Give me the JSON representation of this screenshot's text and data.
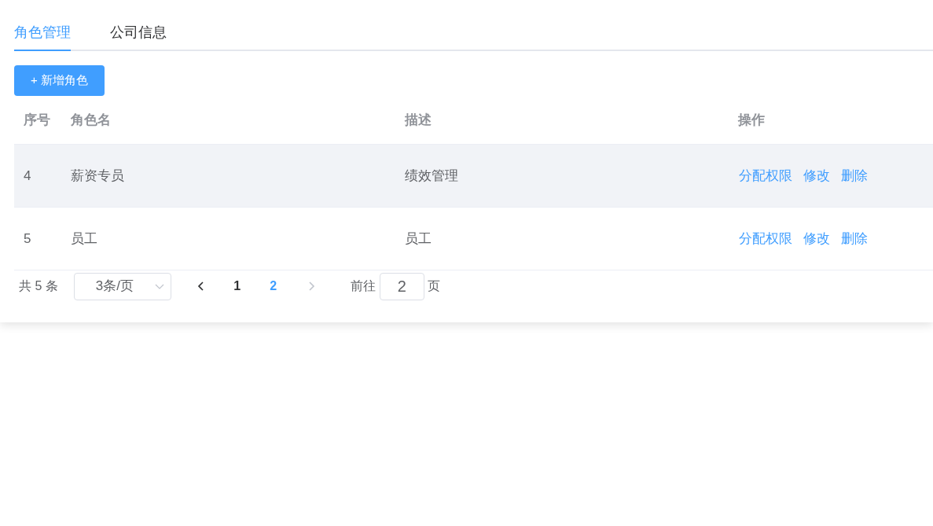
{
  "tabs": [
    {
      "label": "角色管理",
      "selected": true
    },
    {
      "label": "公司信息",
      "selected": false
    }
  ],
  "add_button": {
    "label": "+ 新增角色"
  },
  "table": {
    "columns": [
      "序号",
      "角色名",
      "描述",
      "操作"
    ],
    "rows": [
      {
        "index": "4",
        "name": "薪资专员",
        "description": "绩效管理",
        "hovered": true,
        "actions": [
          "分配权限",
          "修改",
          "删除"
        ]
      },
      {
        "index": "5",
        "name": "员工",
        "description": "员工",
        "hovered": false,
        "actions": [
          "分配权限",
          "修改",
          "删除"
        ]
      }
    ]
  },
  "pagination": {
    "total": "共 5 条",
    "page_size": "3条/页",
    "prev_disabled": false,
    "pages": [
      {
        "label": "1",
        "selected": false
      },
      {
        "label": "2",
        "selected": true
      }
    ],
    "next_disabled": true,
    "goto_label": "前往",
    "goto_value": "2",
    "goto_suffix": "页"
  }
}
